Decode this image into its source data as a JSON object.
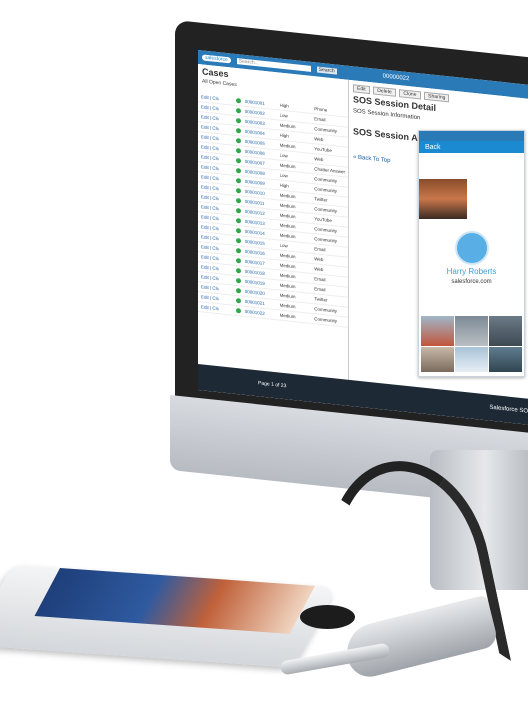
{
  "screen": {
    "brand": "salesforce",
    "search_placeholder": "Search...",
    "search_button": "Search",
    "tab_number": "00000022",
    "cases_title": "Cases",
    "view_label": "All Open Cases",
    "cases": [
      {
        "action": "Edit | Cls",
        "number": "00001001",
        "priority": "High",
        "origin": "Phone"
      },
      {
        "action": "Edit | Cls",
        "number": "00001002",
        "priority": "Low",
        "origin": "Email"
      },
      {
        "action": "Edit | Cls",
        "number": "00001003",
        "priority": "Medium",
        "origin": "Community"
      },
      {
        "action": "Edit | Cls",
        "number": "00001004",
        "priority": "High",
        "origin": "Web"
      },
      {
        "action": "Edit | Cls",
        "number": "00001005",
        "priority": "Medium",
        "origin": "YouTube"
      },
      {
        "action": "Edit | Cls",
        "number": "00001006",
        "priority": "Low",
        "origin": "Web"
      },
      {
        "action": "Edit | Cls",
        "number": "00001007",
        "priority": "Medium",
        "origin": "Chatter Answers"
      },
      {
        "action": "Edit | Cls",
        "number": "00001008",
        "priority": "Low",
        "origin": "Community"
      },
      {
        "action": "Edit | Cls",
        "number": "00001009",
        "priority": "High",
        "origin": "Community"
      },
      {
        "action": "Edit | Cls",
        "number": "00001010",
        "priority": "Medium",
        "origin": "Twitter"
      },
      {
        "action": "Edit | Cls",
        "number": "00001011",
        "priority": "Medium",
        "origin": "Community"
      },
      {
        "action": "Edit | Cls",
        "number": "00001012",
        "priority": "Medium",
        "origin": "YouTube"
      },
      {
        "action": "Edit | Cls",
        "number": "00001013",
        "priority": "Medium",
        "origin": "Community"
      },
      {
        "action": "Edit | Cls",
        "number": "00001014",
        "priority": "Medium",
        "origin": "Community"
      },
      {
        "action": "Edit | Cls",
        "number": "00001015",
        "priority": "Low",
        "origin": "Email"
      },
      {
        "action": "Edit | Cls",
        "number": "00001016",
        "priority": "Medium",
        "origin": "Web"
      },
      {
        "action": "Edit | Cls",
        "number": "00001017",
        "priority": "Medium",
        "origin": "Web"
      },
      {
        "action": "Edit | Cls",
        "number": "00001018",
        "priority": "Medium",
        "origin": "Email"
      },
      {
        "action": "Edit | Cls",
        "number": "00001019",
        "priority": "Medium",
        "origin": "Email"
      },
      {
        "action": "Edit | Cls",
        "number": "00001020",
        "priority": "Medium",
        "origin": "Twitter"
      },
      {
        "action": "Edit | Cls",
        "number": "00001021",
        "priority": "Medium",
        "origin": "Community"
      },
      {
        "action": "Edit | Cls",
        "number": "00001022",
        "priority": "Medium",
        "origin": "Community"
      }
    ],
    "sos_detail_title": "SOS Session Detail",
    "sos_info_label": "SOS Session Information",
    "sos_activities_title": "SOS Session Activities",
    "back_link": "« Back To Top",
    "detail_buttons": [
      "Edit",
      "Delete",
      "Clone",
      "Sharing"
    ],
    "taskbar_label": "Salesforce SOS",
    "pager_text": "Page 1 of 23"
  },
  "phone": {
    "back_label": "Back",
    "contact_name": "Harry Roberts",
    "contact_site": "salesforce.com"
  },
  "colors": {
    "brand_blue": "#1b8ad0",
    "name_blue": "#3aa0d8",
    "status_green": "#2fa94c",
    "taskbar": "#1d2a36"
  }
}
